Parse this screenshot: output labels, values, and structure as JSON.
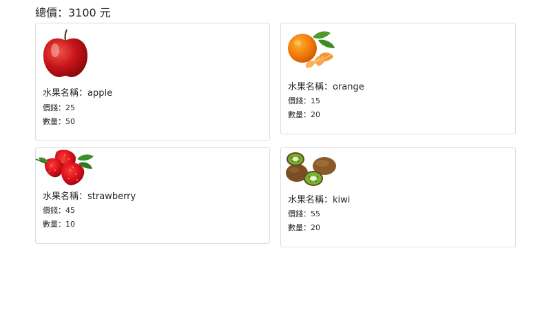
{
  "total": {
    "label": "總價：",
    "amount": "3100",
    "unit": "元",
    "text": "總價：3100 元"
  },
  "fruits": [
    {
      "name_label": "水果名稱：apple",
      "price_label": "價錢：25",
      "qty_label": "數量：50",
      "image_icon": "apple-image"
    },
    {
      "name_label": "水果名稱：orange",
      "price_label": "價錢：15",
      "qty_label": "數量：20",
      "image_icon": "orange-image"
    },
    {
      "name_label": "水果名稱：strawberry",
      "price_label": "價錢：45",
      "qty_label": "數量：10",
      "image_icon": "strawberry-image"
    },
    {
      "name_label": "水果名稱：kiwi",
      "price_label": "價錢：55",
      "qty_label": "數量：20",
      "image_icon": "kiwi-image"
    }
  ]
}
